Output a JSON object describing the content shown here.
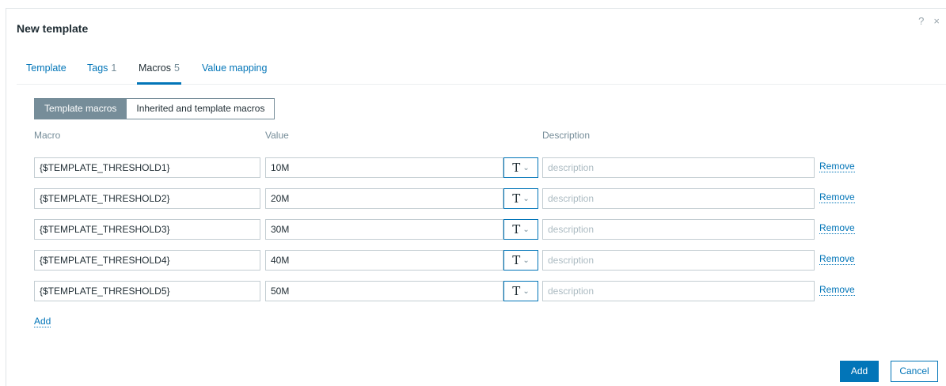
{
  "dialog": {
    "title": "New template",
    "help_icon": "?",
    "close_icon": "×"
  },
  "tabs": [
    {
      "label": "Template",
      "count": ""
    },
    {
      "label": "Tags",
      "count": "1"
    },
    {
      "label": "Macros",
      "count": "5",
      "active": true
    },
    {
      "label": "Value mapping",
      "count": ""
    }
  ],
  "macro_mode": {
    "options": [
      "Template macros",
      "Inherited and template macros"
    ],
    "selected": "Template macros"
  },
  "columns": {
    "macro": "Macro",
    "value": "Value",
    "description": "Description"
  },
  "macros": [
    {
      "macro": "{$TEMPLATE_THRESHOLD1}",
      "value": "10M",
      "type_icon": "T",
      "description_placeholder": "description",
      "remove_label": "Remove"
    },
    {
      "macro": "{$TEMPLATE_THRESHOLD2}",
      "value": "20M",
      "type_icon": "T",
      "description_placeholder": "description",
      "remove_label": "Remove"
    },
    {
      "macro": "{$TEMPLATE_THRESHOLD3}",
      "value": "30M",
      "type_icon": "T",
      "description_placeholder": "description",
      "remove_label": "Remove"
    },
    {
      "macro": "{$TEMPLATE_THRESHOLD4}",
      "value": "40M",
      "type_icon": "T",
      "description_placeholder": "description",
      "remove_label": "Remove"
    },
    {
      "macro": "{$TEMPLATE_THRESHOLD5}",
      "value": "50M",
      "type_icon": "T",
      "description_placeholder": "description",
      "remove_label": "Remove"
    }
  ],
  "add_link": "Add",
  "footer": {
    "add_label": "Add",
    "cancel_label": "Cancel"
  },
  "colors": {
    "accent": "#0275b8",
    "toggle_active": "#768d99"
  }
}
